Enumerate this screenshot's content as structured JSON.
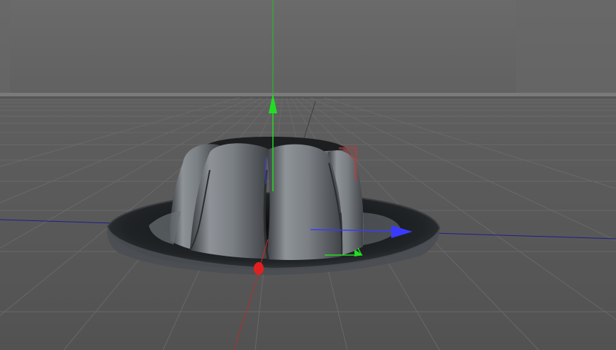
{
  "viewport": {
    "view": "perspective",
    "background_upper": "#626262",
    "background_lower": "#565656",
    "grid_color": "#6e6e6e",
    "horizon_color": "#7a7a7a"
  },
  "object": {
    "name": "jelly-mold",
    "body_color": "#7d8287",
    "shadow_color": "#2a2c2e",
    "rim_color": "#1f2123"
  },
  "gizmo": {
    "x_axis_color": "#3a3aff",
    "y_axis_color": "#22dd22",
    "z_axis_color": "#dd2222",
    "x_arrow_icon": "x-axis-arrow-icon",
    "y_arrow_icon": "y-axis-arrow-icon",
    "z_handle_icon": "z-axis-handle-icon"
  }
}
